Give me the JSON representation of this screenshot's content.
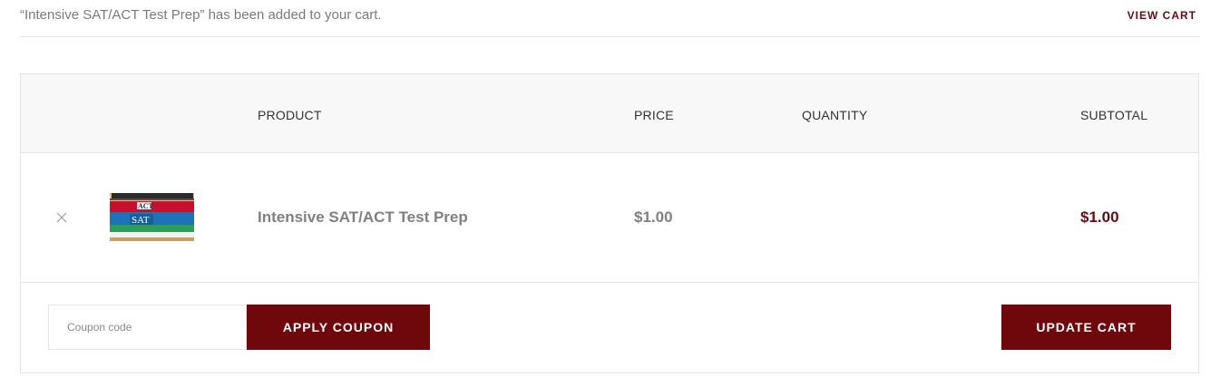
{
  "notice": {
    "message": "“Intensive SAT/ACT Test Prep” has been added to your cart.",
    "view_cart_label": "VIEW CART"
  },
  "table": {
    "headers": {
      "product": "PRODUCT",
      "price": "PRICE",
      "quantity": "QUANTITY",
      "subtotal": "SUBTOTAL"
    },
    "items": [
      {
        "remove_icon": "close-icon",
        "thumbnail_labels": [
          "ACT",
          "SAT"
        ],
        "name": "Intensive SAT/ACT Test Prep",
        "price": "$1.00",
        "subtotal": "$1.00"
      }
    ]
  },
  "actions": {
    "coupon_placeholder": "Coupon code",
    "apply_coupon_label": "APPLY COUPON",
    "update_cart_label": "UPDATE CART"
  },
  "colors": {
    "accent": "#6e080d",
    "muted_text": "#808080",
    "border": "#e4e4e4",
    "header_bg": "#f8f8f8"
  }
}
